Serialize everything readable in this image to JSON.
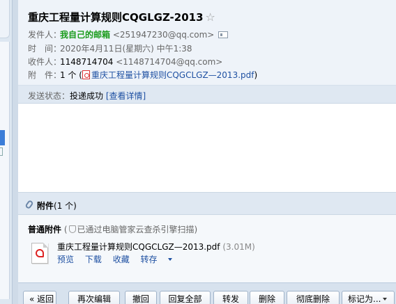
{
  "email": {
    "subject": "重庆工程量计算规则CQGLGZ-2013",
    "star": "☆",
    "sender_label": "发件人：",
    "sender_name": "我自己的邮箱",
    "sender_address": "<251947230@qq.com>",
    "time_label": "时　间：",
    "time_value": "2020年4月11日(星期六) 中午1:38",
    "recipient_label": "收件人：",
    "recipient_name": "1148714704",
    "recipient_address": "<1148714704@qq.com>",
    "attachment_label": "附　件：",
    "attachment_count": "1 个 (",
    "attachment_link": "重庆工程量计算规则CQGCLGZ—2013.pdf",
    "attachment_close": ")",
    "status_label": "发送状态：",
    "status_value": "投递成功",
    "status_detail": "[查看详情]"
  },
  "attachments": {
    "title": "附件",
    "count": "(1 个)",
    "normal_label": "普通附件",
    "scan_open": "(",
    "scan_note": "已通过电脑管家云查杀引擎扫描",
    "scan_close": ")",
    "file": {
      "name": "重庆工程量计算规则CQGCLGZ—2013.pdf",
      "size": "(3.01M)",
      "actions": [
        "预览",
        "下载",
        "收藏",
        "转存"
      ]
    }
  },
  "toolbar": {
    "back": "« 返回",
    "reedit": "再次编辑",
    "recall": "撤回",
    "reply_all": "回复全部",
    "forward": "转发",
    "delete": "删除",
    "delete_permanent": "彻底删除",
    "mark_as": "标记为..."
  },
  "colors": {
    "link": "#1e50a2",
    "sender_green": "#199b1b",
    "header_bg": "#eef3f9",
    "bar_bg": "#dfe8f2"
  }
}
